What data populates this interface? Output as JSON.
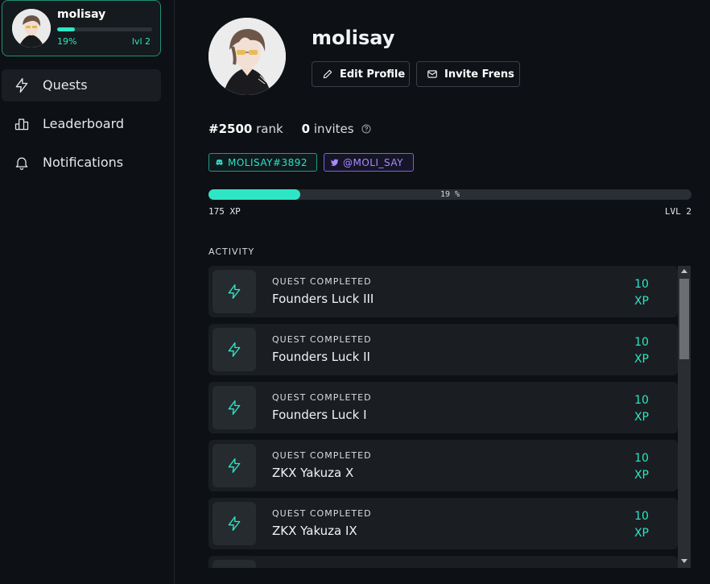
{
  "user": {
    "username": "molisay",
    "progress_percent": 19,
    "progress_text": "19%",
    "level_short": "lvl 2"
  },
  "nav": [
    {
      "label": "Quests",
      "icon": "lightning-icon",
      "active": true
    },
    {
      "label": "Leaderboard",
      "icon": "leaderboard-icon",
      "active": false
    },
    {
      "label": "Notifications",
      "icon": "bell-icon",
      "active": false
    }
  ],
  "profile": {
    "name": "molisay",
    "edit_label": "Edit Profile",
    "invite_label": "Invite Frens",
    "rank_value": "#2500",
    "rank_label": "rank",
    "invites_value": "0",
    "invites_label": "invites",
    "discord_tag": "MOLISAY#3892",
    "twitter_tag": "@MOLI_SAY"
  },
  "xp": {
    "percent": 19,
    "percent_text": "19 %",
    "xp_text": "175 XP",
    "level_text": "LVL 2"
  },
  "activity": {
    "title": "ACTIVITY",
    "items": [
      {
        "kind": "QUEST COMPLETED",
        "name": "Founders Luck III",
        "points": "10",
        "unit": "XP"
      },
      {
        "kind": "QUEST COMPLETED",
        "name": "Founders Luck II",
        "points": "10",
        "unit": "XP"
      },
      {
        "kind": "QUEST COMPLETED",
        "name": "Founders Luck I",
        "points": "10",
        "unit": "XP"
      },
      {
        "kind": "QUEST COMPLETED",
        "name": "ZKX Yakuza X",
        "points": "10",
        "unit": "XP"
      },
      {
        "kind": "QUEST COMPLETED",
        "name": "ZKX Yakuza IX",
        "points": "10",
        "unit": "XP"
      },
      {
        "kind": "",
        "name": "",
        "points": "",
        "unit": ""
      }
    ]
  },
  "colors": {
    "accent": "#2ee6c5",
    "background": "#0d1014",
    "card": "#1a1e22",
    "discord": "#2ee0c8",
    "twitter": "#a78cff"
  }
}
